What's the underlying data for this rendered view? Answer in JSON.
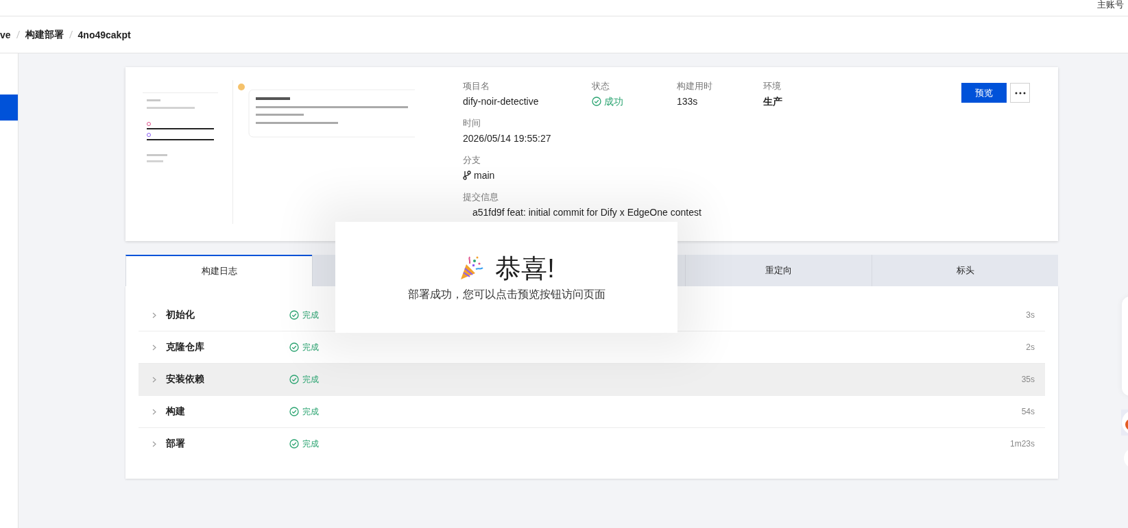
{
  "header": {
    "account": "主账号"
  },
  "breadcrumb": [
    "ve",
    "构建部署",
    "4no49cakpt"
  ],
  "sidebar": {
    "items": [
      {
        "selected": true
      }
    ]
  },
  "deployment": {
    "summary": [
      {
        "label": "项目名",
        "value": "dify-noir-detective",
        "kind": "text"
      },
      {
        "label": "状态",
        "value": "成功",
        "kind": "status"
      },
      {
        "label": "构建用时",
        "value": "133s",
        "kind": "text"
      },
      {
        "label": "环境",
        "value": "生产",
        "kind": "text"
      }
    ],
    "details": [
      {
        "label": "时间",
        "value": "2026/05/14 19:55:27",
        "kind": "text"
      },
      {
        "label": "分支",
        "value": "main",
        "kind": "branch"
      },
      {
        "label": "提交信息",
        "value": "a51fd9f feat: initial commit for Dify x EdgeOne contest",
        "kind": "commit"
      }
    ],
    "preview_button": "预览"
  },
  "tabs": [
    {
      "label": "构建日志",
      "selected": true
    },
    {
      "label": "重定向",
      "selected": false
    },
    {
      "label": "标头",
      "selected": false
    }
  ],
  "build_steps": [
    {
      "name": "初始化",
      "status": "完成",
      "duration": "3s",
      "highlighted": false
    },
    {
      "name": "克隆仓库",
      "status": "完成",
      "duration": "2s",
      "highlighted": false
    },
    {
      "name": "安装依赖",
      "status": "完成",
      "duration": "35s",
      "highlighted": true
    },
    {
      "name": "构建",
      "status": "完成",
      "duration": "54s",
      "highlighted": false
    },
    {
      "name": "部署",
      "status": "完成",
      "duration": "1m23s",
      "highlighted": false
    }
  ],
  "dialog": {
    "title": "恭喜!",
    "message": "部署成功，您可以点击预览按钮访问页面"
  }
}
